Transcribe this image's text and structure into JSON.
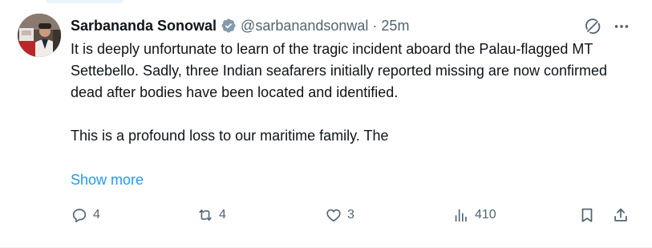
{
  "tweet": {
    "author": {
      "name": "Sarbananda Sonowal",
      "handle": "@sarbanandsonwal",
      "verified": true,
      "verified_color": "#829aab"
    },
    "separator": "·",
    "time": "25m",
    "text_paragraphs": [
      "It is deeply unfortunate to learn of the tragic incident aboard the Palau-flagged MT Settebello. Sadly, three Indian seafarers initially reported missing are now confirmed dead after bodies have been located and identified.",
      "This is a profound loss to our maritime family. The"
    ],
    "show_more_label": "Show more",
    "actions": {
      "replies": "4",
      "reposts": "4",
      "likes": "3",
      "views": "410"
    },
    "icons": [
      "grok-icon",
      "more-icon",
      "reply-icon",
      "repost-icon",
      "like-icon",
      "views-icon",
      "bookmark-icon",
      "share-icon"
    ]
  },
  "colors": {
    "text": "#0f1419",
    "secondary": "#536471",
    "link": "#1d9bf0"
  }
}
